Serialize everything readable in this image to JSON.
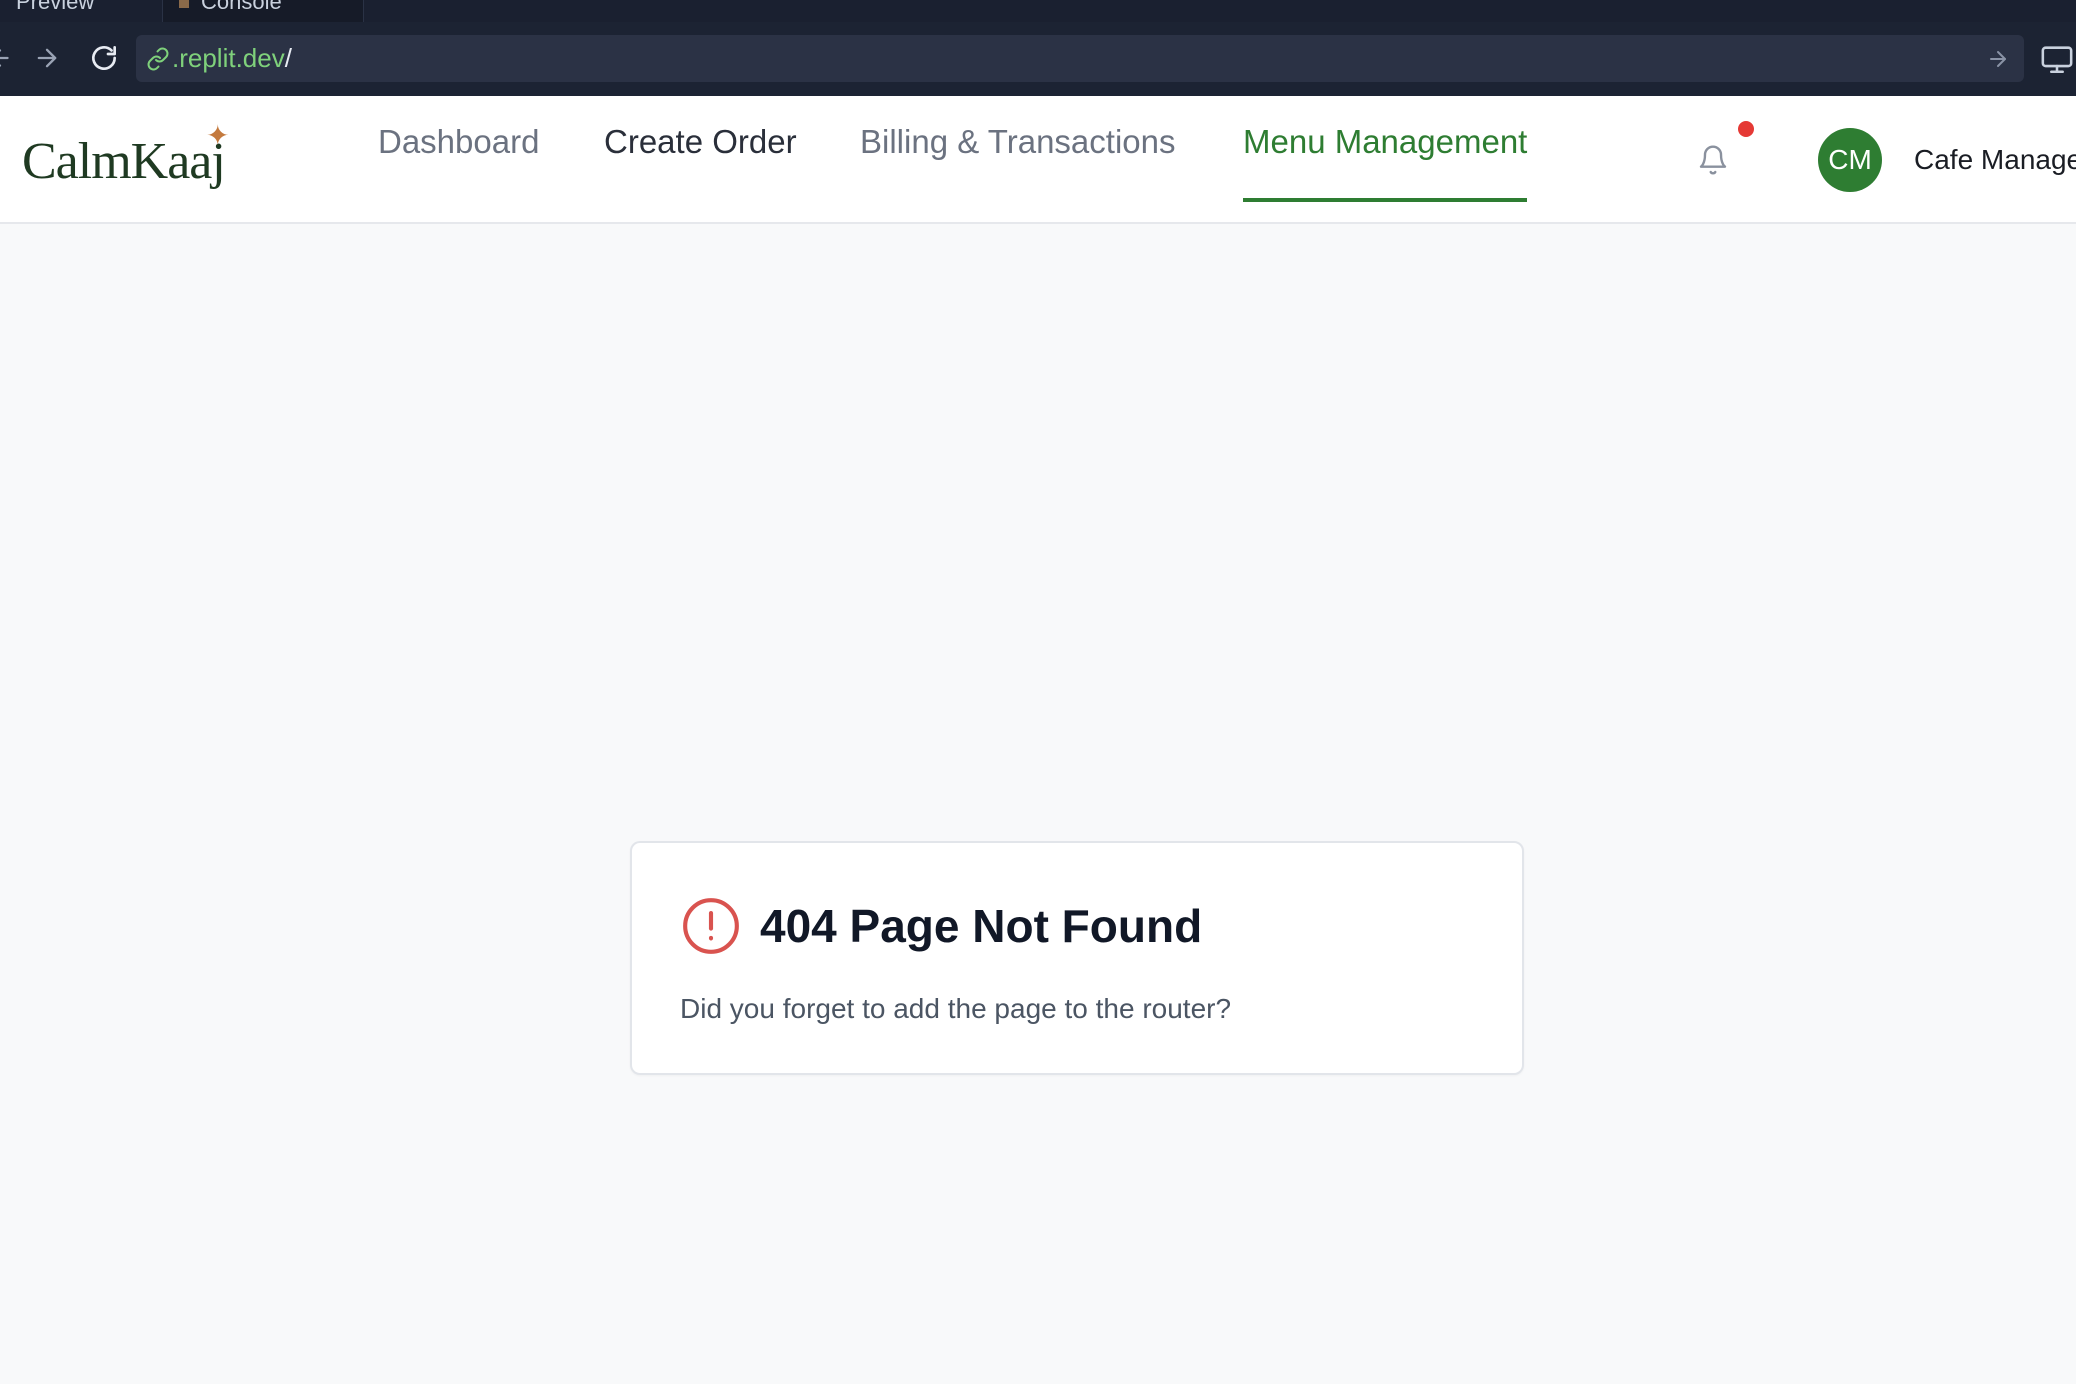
{
  "browser": {
    "tabs": [
      {
        "label": "Preview"
      },
      {
        "label": "Console"
      }
    ],
    "url": {
      "host": ".replit.dev",
      "path": "/"
    }
  },
  "app": {
    "logo": {
      "text": "CalmKaaj",
      "mark": "✦"
    },
    "nav": [
      {
        "label": "Dashboard"
      },
      {
        "label": "Create Order"
      },
      {
        "label": "Billing & Transactions"
      },
      {
        "label": "Menu Management",
        "active": true
      }
    ],
    "user": {
      "initials": "CM",
      "name": "Cafe Manager"
    },
    "notifications": {
      "has_unread": true
    }
  },
  "error_card": {
    "title": "404 Page Not Found",
    "description": "Did you forget to add the page to the router?"
  },
  "colors": {
    "accent": "#2e7d32",
    "error": "#d9534f",
    "notification": "#e53935",
    "logo_star": "#c47a3e"
  },
  "icons": {
    "back": "arrow-left-icon",
    "forward": "arrow-right-icon",
    "reload": "reload-icon",
    "link": "link-icon",
    "go": "arrow-right-icon",
    "device": "monitor-icon",
    "bell": "bell-icon",
    "error": "alert-circle-icon"
  }
}
